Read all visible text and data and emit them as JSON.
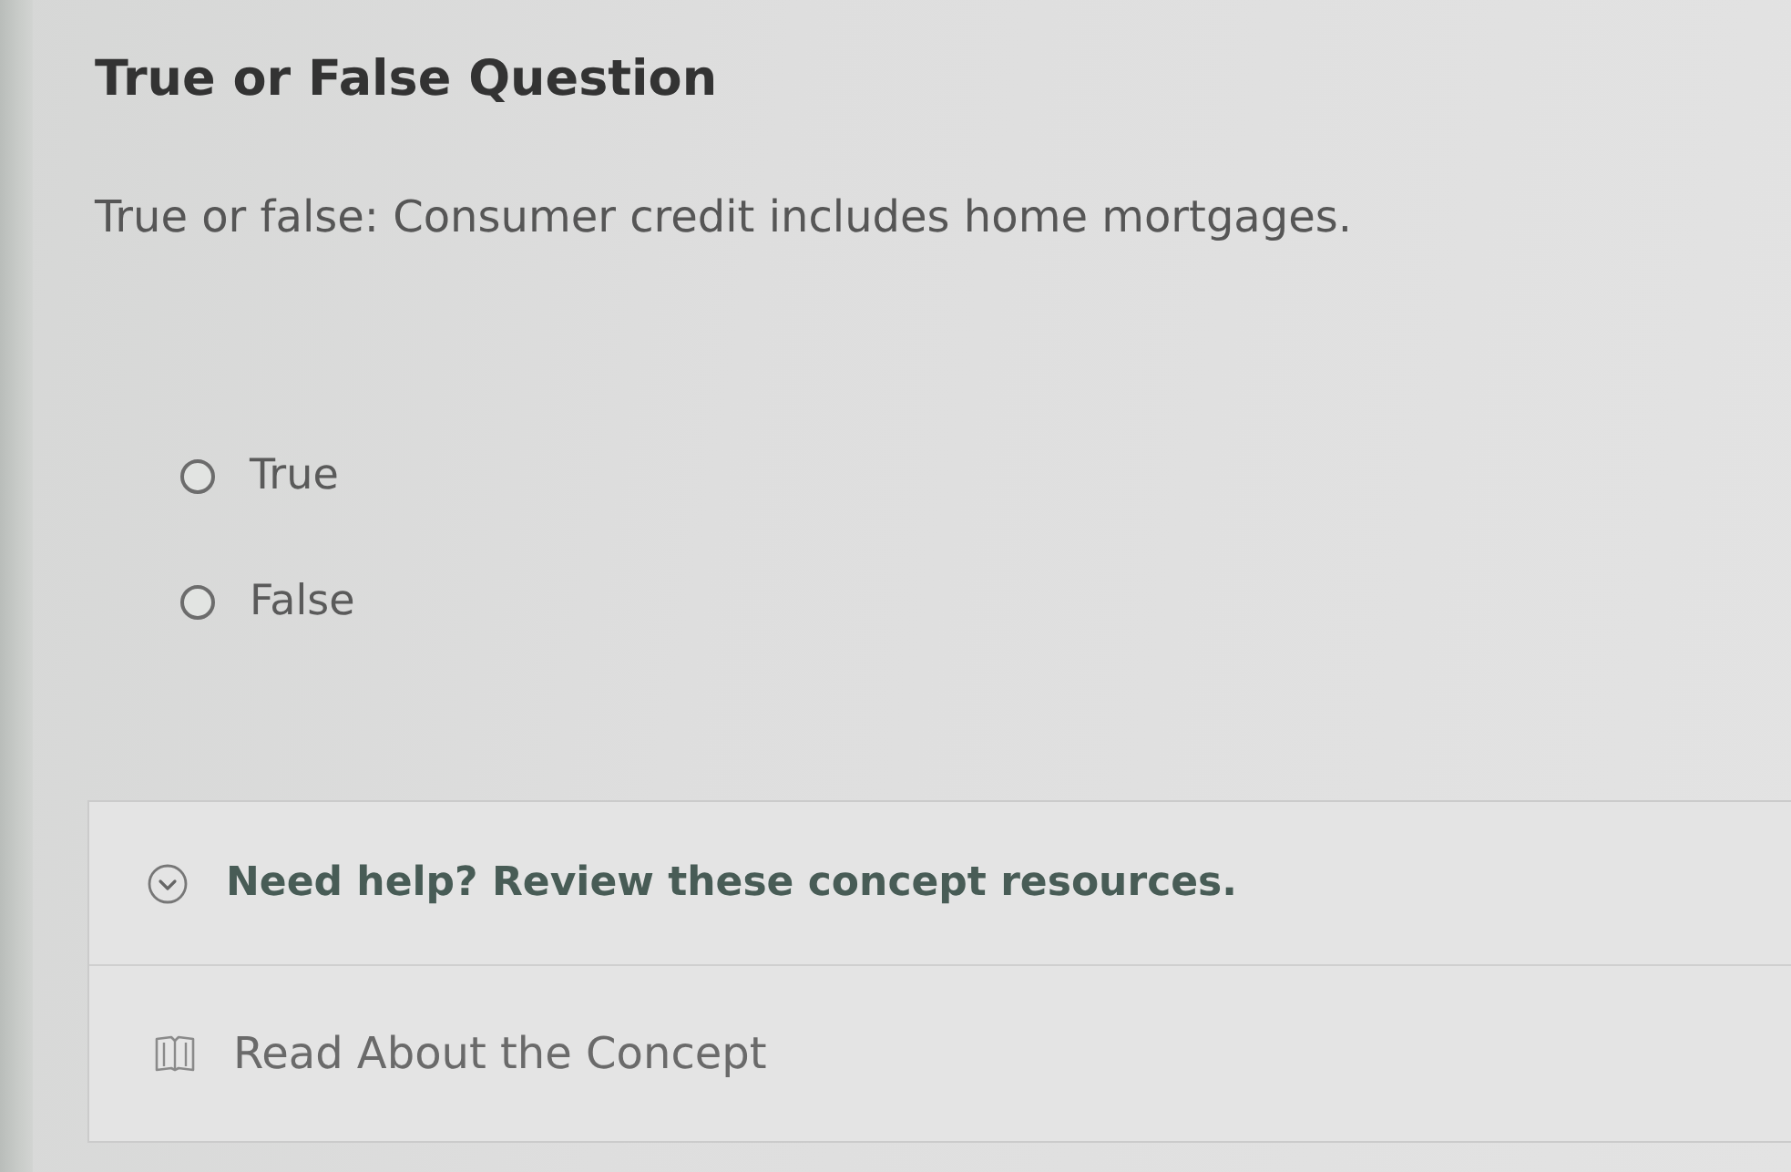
{
  "question": {
    "title": "True or False Question",
    "prompt": "True or false: Consumer credit includes home mortgages.",
    "options": [
      {
        "label": "True",
        "selected": false
      },
      {
        "label": "False",
        "selected": false
      }
    ]
  },
  "help": {
    "heading": "Need help? Review these concept resources.",
    "expanded": true,
    "resources": [
      {
        "label": "Read About the Concept"
      }
    ]
  }
}
